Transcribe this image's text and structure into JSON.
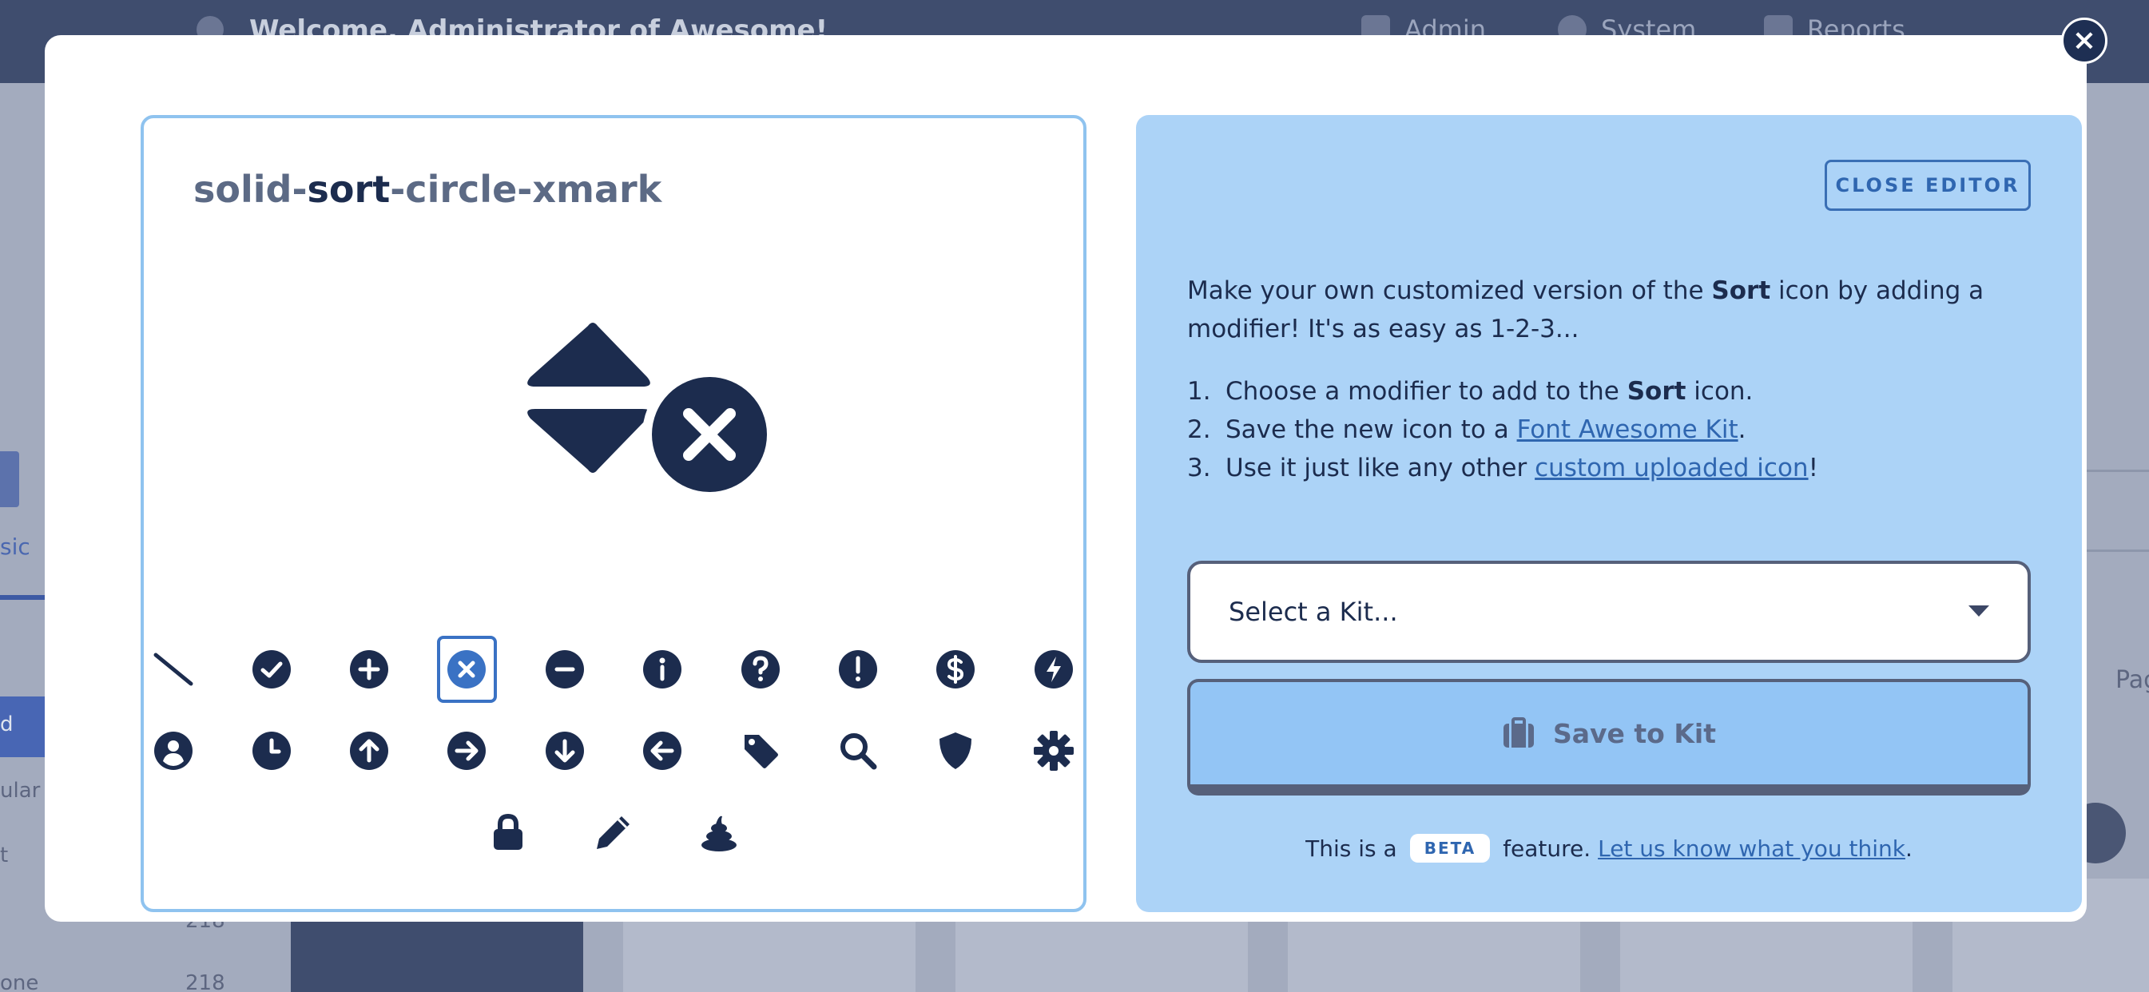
{
  "background": {
    "welcome": "Welcome, Administrator of Awesome!",
    "nav": [
      "Admin",
      "System",
      "Reports"
    ],
    "left_tab": "sic",
    "left_items": [
      "d",
      "ular",
      "t",
      "one"
    ],
    "numbers": [
      "218",
      "218"
    ],
    "right_label": "Pag"
  },
  "modal": {
    "close_icon": "xmark-icon",
    "title": {
      "prefix": "solid-",
      "name": "sort",
      "suffix": "-circle-xmark"
    },
    "modifiers": [
      [
        "slash",
        "check",
        "plus",
        "xmark",
        "minus",
        "info",
        "question",
        "exclamation",
        "dollar",
        "bolt"
      ],
      [
        "user",
        "clock",
        "arrow-up",
        "arrow-right",
        "arrow-down",
        "arrow-left",
        "tag",
        "magnifying-glass",
        "shield",
        "gear"
      ],
      [
        "lock",
        "pencil",
        "poo"
      ]
    ],
    "selected_modifier": "xmark",
    "editor": {
      "close_label": "CLOSE EDITOR",
      "intro_1": "Make your own customized version of the ",
      "intro_bold": "Sort",
      "intro_2": " icon by adding a modifier! It's as easy as 1-2-3...",
      "step1_a": "Choose a modifier to add to the ",
      "step1_bold": "Sort",
      "step1_b": " icon.",
      "step2_a": "Save the new icon to a ",
      "step2_link": "Font Awesome Kit",
      "step2_b": ".",
      "step3_a": "Use it just like any other ",
      "step3_link": "custom uploaded icon",
      "step3_b": "!",
      "kit_placeholder": "Select a Kit...",
      "save_label": "Save to Kit",
      "beta_pre": "This is a",
      "beta_badge": "BETA",
      "beta_mid": "feature.",
      "beta_link": "Let us know what you think",
      "beta_end": "."
    }
  },
  "colors": {
    "navy": "#1c2c4e",
    "accent": "#3a72c4",
    "panel_blue": "#acd3f7",
    "button_blue": "#93c5f5"
  }
}
